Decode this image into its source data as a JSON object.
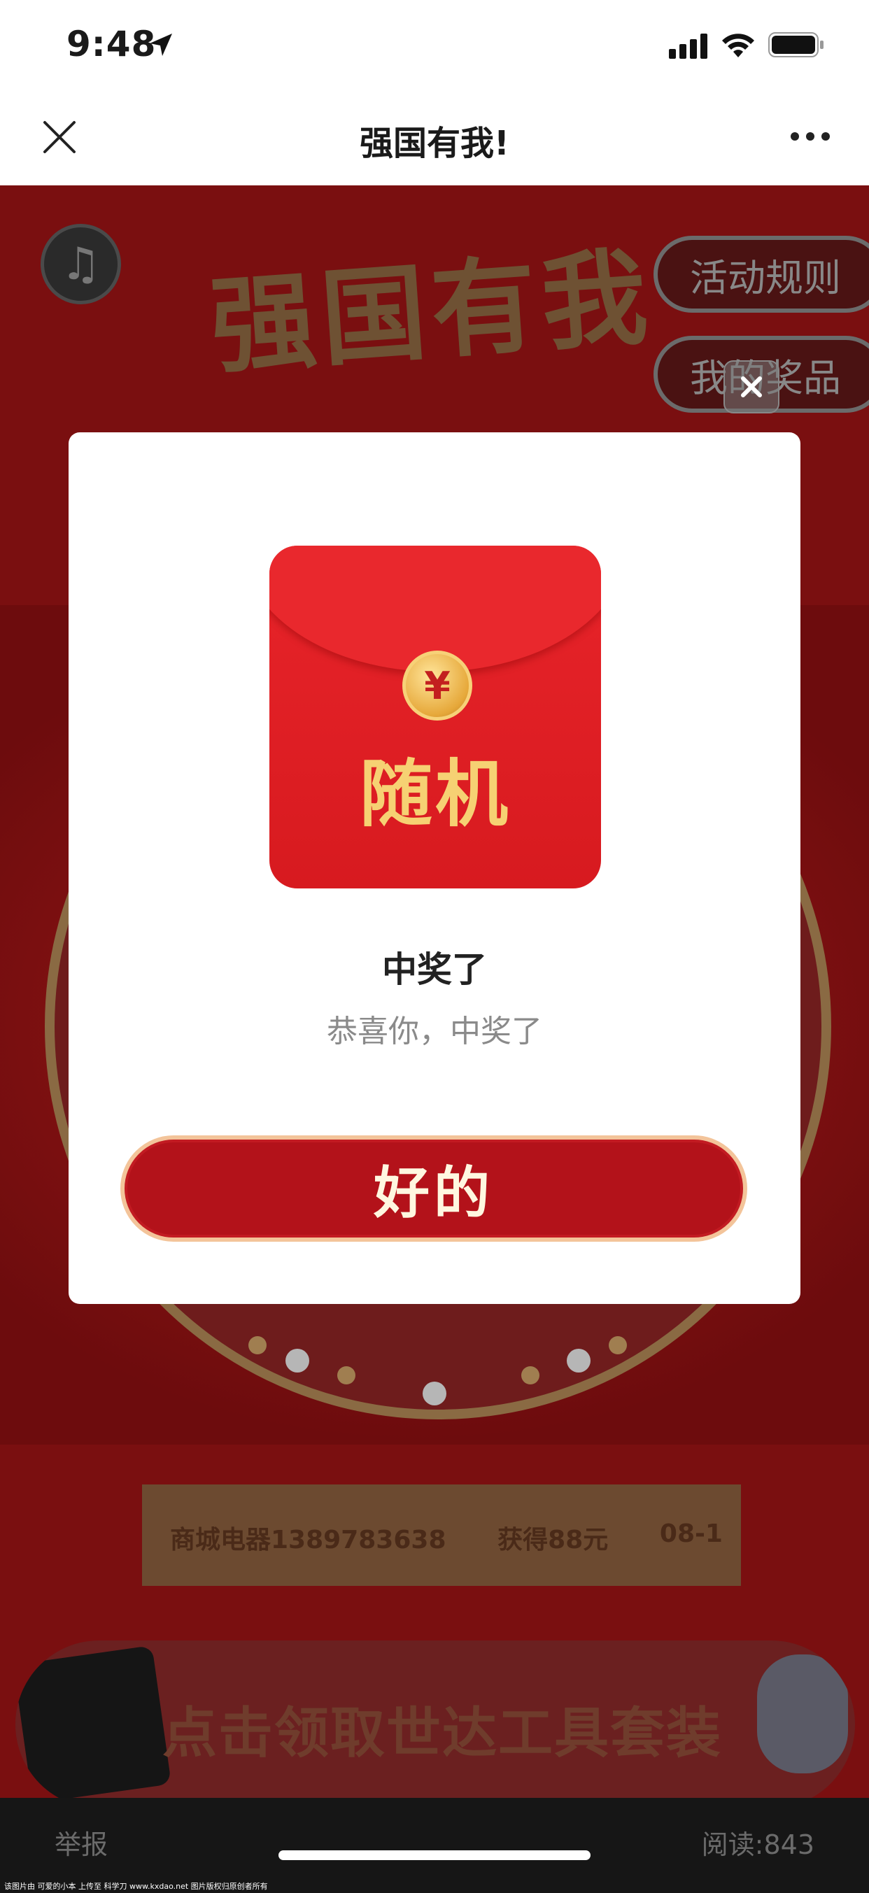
{
  "status_bar": {
    "time": "9:48"
  },
  "nav": {
    "title": "强国有我!"
  },
  "page": {
    "hero_title": "强国有我",
    "rules_button": "活动规则",
    "prizes_button": "我的奖品",
    "winner": {
      "name": "商城电器1389783638",
      "prize": "获得88元",
      "date": "08-1"
    },
    "banner_text": "点击领取世达工具套装"
  },
  "bottom_bar": {
    "report": "举报",
    "read_count": "阅读:843"
  },
  "modal": {
    "envelope_symbol": "¥",
    "envelope_label": "随机",
    "title": "中奖了",
    "subtitle": "恭喜你，中奖了",
    "ok_label": "好的"
  },
  "watermark": "该图片由 可爱的小本 上传至 科学刀 www.kxdao.net 图片版权归原创者所有",
  "colors": {
    "brand_red": "#b3121a",
    "envelope_red": "#e8242a",
    "gold": "#f6d173"
  }
}
